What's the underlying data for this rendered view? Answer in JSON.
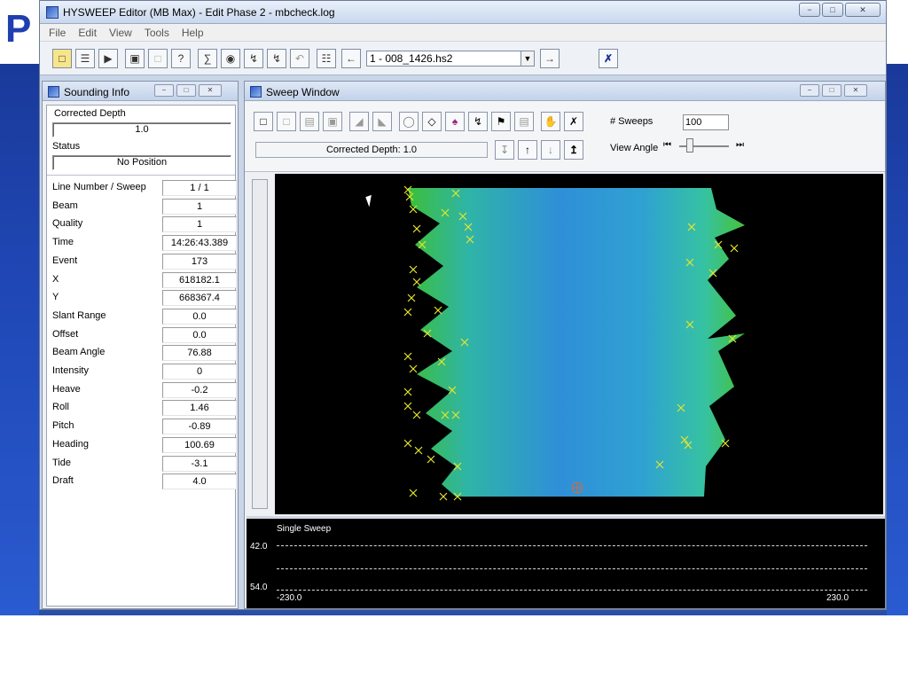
{
  "window": {
    "title": "HYSWEEP Editor (MB Max) - Edit Phase 2 - mbcheck.log",
    "minimize": "−",
    "maximize": "□",
    "close": "✕"
  },
  "slide": {
    "letter": "P"
  },
  "menu": [
    "File",
    "Edit",
    "View",
    "Tools",
    "Help"
  ],
  "toolbar": {
    "file_value": "1 - 008_1426.hs2",
    "icons": [
      "open-folder-icon",
      "import-icon",
      "play-icon",
      "save-icon",
      "blank-icon",
      "help-icon",
      "filter-icon",
      "binoculars-icon",
      "flag-lightning-icon",
      "flag-lightning-2-icon",
      "undo-icon",
      "list-icon",
      "arrow-left-icon",
      "arrow-right-icon",
      "close-x-icon"
    ]
  },
  "sounding": {
    "title": "Sounding Info",
    "corrected_depth_label": "Corrected Depth",
    "corrected_depth_value": "1.0",
    "status_label": "Status",
    "status_value": "No Position",
    "rows": [
      {
        "label": "Line Number / Sweep",
        "value": "1 / 1"
      },
      {
        "label": "Beam",
        "value": "1"
      },
      {
        "label": "Quality",
        "value": "1"
      },
      {
        "label": "Time",
        "value": "14:26:43.389"
      },
      {
        "label": "Event",
        "value": "173"
      },
      {
        "label": "X",
        "value": "618182.1"
      },
      {
        "label": "Y",
        "value": "668367.4"
      },
      {
        "label": "Slant Range",
        "value": "0.0"
      },
      {
        "label": "Offset",
        "value": "0.0"
      },
      {
        "label": "Beam Angle",
        "value": "76.88"
      },
      {
        "label": "Intensity",
        "value": "0"
      },
      {
        "label": "Heave",
        "value": "-0.2"
      },
      {
        "label": "Roll",
        "value": "1.46"
      },
      {
        "label": "Pitch",
        "value": "-0.89"
      },
      {
        "label": "Heading",
        "value": "100.69"
      },
      {
        "label": "Tide",
        "value": "-3.1"
      },
      {
        "label": "Draft",
        "value": "4.0"
      }
    ]
  },
  "sweep": {
    "title": "Sweep Window",
    "depth_text": "Corrected Depth: 1.0",
    "nsweeps_label": "# Sweeps",
    "nsweeps_value": "100",
    "viewangle_label": "View Angle",
    "single_sweep_label": "Single Sweep",
    "depth_top": "42.0",
    "depth_bottom": "54.0",
    "x_left": "-230.0",
    "x_right": "230.0"
  },
  "colors": {
    "swath_center": "#2f8fd8",
    "swath_edge": "#3fbf4a",
    "marker": "#e6e62a"
  }
}
